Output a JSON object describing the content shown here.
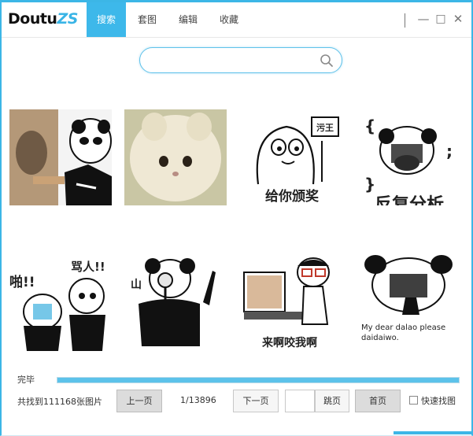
{
  "app": {
    "logo_main": "Doutu",
    "logo_accent": "ZS"
  },
  "tabs": [
    {
      "label": "搜索",
      "active": true
    },
    {
      "label": "套图",
      "active": false
    },
    {
      "label": "编辑",
      "active": false
    },
    {
      "label": "收藏",
      "active": false
    }
  ],
  "window_controls": {
    "minimize": "—",
    "maximize": "□",
    "close": "✕"
  },
  "search": {
    "value": "",
    "placeholder": "",
    "icon": "search-icon"
  },
  "results": [
    {
      "name": "panda-man-holding-cat",
      "caption": ""
    },
    {
      "name": "fluffy-white-cat",
      "caption": ""
    },
    {
      "name": "doodle-ghost-award",
      "caption": "给你颁奖",
      "badge": "污王"
    },
    {
      "name": "panda-covering-mouth",
      "caption": "反复分析"
    },
    {
      "name": "panda-shouting-duo",
      "caption": "骂人!!",
      "side_text": "啪!!"
    },
    {
      "name": "panda-magnifier",
      "caption": "",
      "side_text": "山"
    },
    {
      "name": "cartoon-boy-computer",
      "caption": "来啊咬我啊"
    },
    {
      "name": "panda-dear-dalao",
      "caption": "My dear dalao please daidaiwo."
    }
  ],
  "progress": {
    "label": "完毕",
    "fraction": 1.0
  },
  "status": {
    "count_text": "共找到111168张图片",
    "page_indicator": "1/13896"
  },
  "pagination": {
    "prev_label": "上一页",
    "next_label": "下一页",
    "jump_label": "跳页",
    "jump_value": "",
    "home_label": "首页",
    "quick_find_label": "快速找图",
    "quick_find_checked": false
  },
  "colors": {
    "accent": "#3db8ea",
    "border": "#3cb6e6"
  }
}
